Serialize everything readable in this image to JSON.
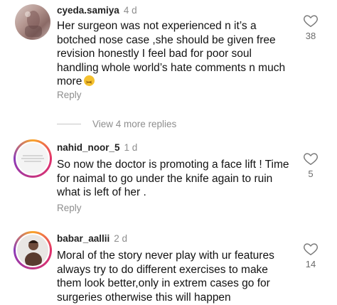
{
  "comments": [
    {
      "username": "cyeda.samiya",
      "age": "4 d",
      "text_lines": [
        "Her surgeon was not experienced n it’s a",
        "botched nose case ,she should be given free",
        "revision honestly I feel bad for poor soul",
        "handling whole world’s hate comments n much",
        "more"
      ],
      "likes": "38",
      "reply_label": "Reply"
    },
    {
      "username": "nahid_noor_5",
      "age": "1 d",
      "text_lines": [
        "So now the doctor is promoting a face lift ! Time",
        "for naimal to go under the knife again to ruin",
        "what is left of her ."
      ],
      "likes": "5",
      "reply_label": "Reply"
    },
    {
      "username": "babar_aallii",
      "age": "2 d",
      "text_lines": [
        "Moral of the story never play with ur features",
        "always try to do different exercises to make",
        "them look better,only in extrem cases go for",
        "surgeries otherwise this will happen"
      ],
      "likes": "14"
    }
  ],
  "view_more_replies": "View 4 more replies",
  "colors": {
    "secondary_text": "#8e8e8e",
    "story_ring": "#e1306c",
    "emoji": "#f5c12e"
  },
  "icons": {
    "like": "heart-outline-icon",
    "emoji": "confounded-face-emoji"
  }
}
